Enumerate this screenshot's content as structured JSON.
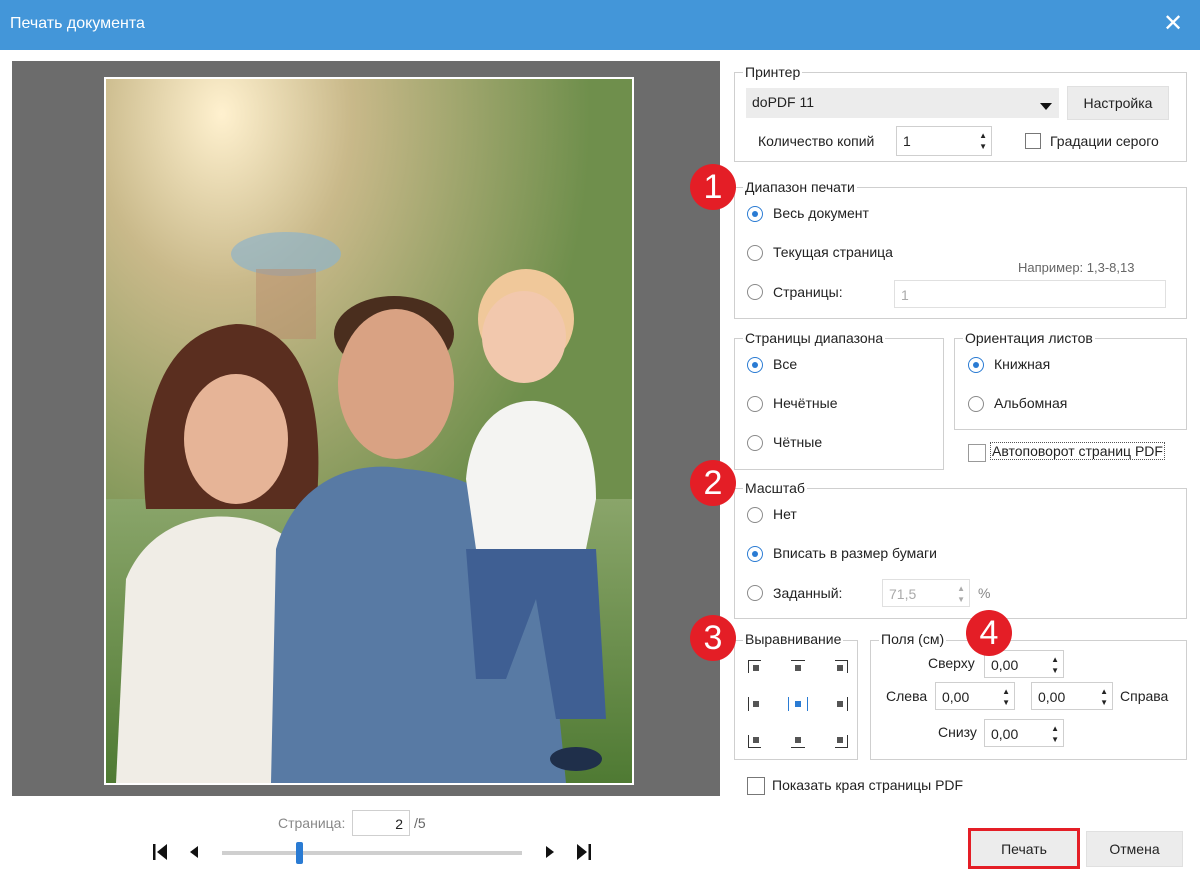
{
  "window": {
    "title": "Печать документа"
  },
  "printer": {
    "group_label": "Принтер",
    "selected": "doPDF 11",
    "settings_button": "Настройка",
    "copies_label": "Количество копий",
    "copies_value": "1",
    "grayscale_label": "Градации серого",
    "grayscale_checked": false
  },
  "print_range": {
    "group_label": "Диапазон печати",
    "options": [
      "Весь документ",
      "Текущая страница",
      "Страницы:"
    ],
    "selected_index": 0,
    "pages_value": "1",
    "example_hint": "Например: 1,3-8,13"
  },
  "range_pages": {
    "group_label": "Страницы диапазона",
    "options": [
      "Все",
      "Нечётные",
      "Чётные"
    ],
    "selected_index": 0
  },
  "orientation": {
    "group_label": "Ориентация листов",
    "options": [
      "Книжная",
      "Альбомная"
    ],
    "selected_index": 0,
    "autorotate_label": "Автоповорот страниц PDF",
    "autorotate_checked": false
  },
  "scale": {
    "group_label": "Масштаб",
    "options": [
      "Нет",
      "Вписать в размер бумаги",
      "Заданный:"
    ],
    "selected_index": 1,
    "custom_value": "71,5",
    "unit": "%"
  },
  "alignment": {
    "group_label": "Выравнивание",
    "selected": "center"
  },
  "margins": {
    "group_label": "Поля (см)",
    "top_label": "Сверху",
    "top_value": "0,00",
    "left_label": "Слева",
    "left_value": "0,00",
    "right_label": "Справа",
    "right_value": "0,00",
    "bottom_label": "Снизу",
    "bottom_value": "0,00"
  },
  "show_edges": {
    "label": "Показать края страницы PDF",
    "checked": false
  },
  "pager": {
    "label": "Страница:",
    "current": "2",
    "total": "/5",
    "slider_fraction": 0.26
  },
  "buttons": {
    "print": "Печать",
    "cancel": "Отмена"
  },
  "badges": [
    "1",
    "2",
    "3",
    "4"
  ],
  "colors": {
    "titlebar": "#4396d9",
    "badge": "#e41e26",
    "highlight": "#e41e26"
  }
}
